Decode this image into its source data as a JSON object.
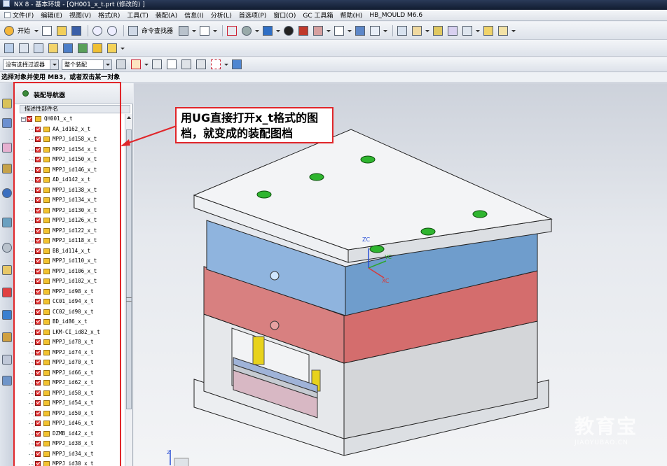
{
  "window": {
    "title": "NX 8 - 基本环境 - [QH001_x_t.prt (修改的) ]"
  },
  "menu": [
    "文件(F)",
    "编辑(E)",
    "视图(V)",
    "格式(R)",
    "工具(T)",
    "装配(A)",
    "信息(I)",
    "分析(L)",
    "首选项(P)",
    "窗口(O)",
    "GC 工具箱",
    "帮助(H)",
    "HB_MOULD M6.6"
  ],
  "toolbar": {
    "start_label": "开始",
    "command_finder_label": "命令查找器"
  },
  "filters": {
    "type_filter": "没有选择过滤器",
    "scope_filter": "整个装配"
  },
  "cue_line": "选择对象并使用 MB3，或者双击某一对象",
  "navigator": {
    "title": "装配导航器",
    "column_header": "描述性部件名",
    "root": "QH001_x_t",
    "items": [
      "AA_id162_x_t",
      "MPPJ_id158_x_t",
      "MPPJ_id154_x_t",
      "MPPJ_id150_x_t",
      "MPPJ_id146_x_t",
      "AD_id142_x_t",
      "MPPJ_id138_x_t",
      "MPPJ_id134_x_t",
      "MPPJ_id130_x_t",
      "MPPJ_id126_x_t",
      "MPPJ_id122_x_t",
      "MPPJ_id118_x_t",
      "BB_id114_x_t",
      "MPPJ_id110_x_t",
      "MPPJ_id106_x_t",
      "MPPJ_id102_x_t",
      "MPPJ_id98_x_t",
      "CC01_id94_x_t",
      "CC02_id90_x_t",
      "BD_id86_x_t",
      "LKM-CI_id82_x_t",
      "MPPJ_id78_x_t",
      "MPPJ_id74_x_t",
      "MPPJ_id70_x_t",
      "MPPJ_id66_x_t",
      "MPPJ_id62_x_t",
      "MPPJ_id58_x_t",
      "MPPJ_id54_x_t",
      "MPPJ_id50_x_t",
      "MPPJ_id46_x_t",
      "DZMB_id42_x_t",
      "MPPJ_id38_x_t",
      "MPPJ_id34_x_t",
      "MPPJ_id30_x_t"
    ]
  },
  "annotation": {
    "line1": "用UG直接打开x_t格式的图",
    "line2": "档，就变成的装配图档"
  },
  "axes": {
    "zc": "ZC",
    "yc": "YC",
    "xc": "XC"
  },
  "watermark": {
    "cn": "教育宝",
    "en": "JIAOYUBAO.CN"
  },
  "colors": {
    "accent_red": "#e0262a",
    "blue_plate": "#6f9dcc",
    "red_plate": "#d46d6d",
    "green_marks": "#2fb52f"
  }
}
